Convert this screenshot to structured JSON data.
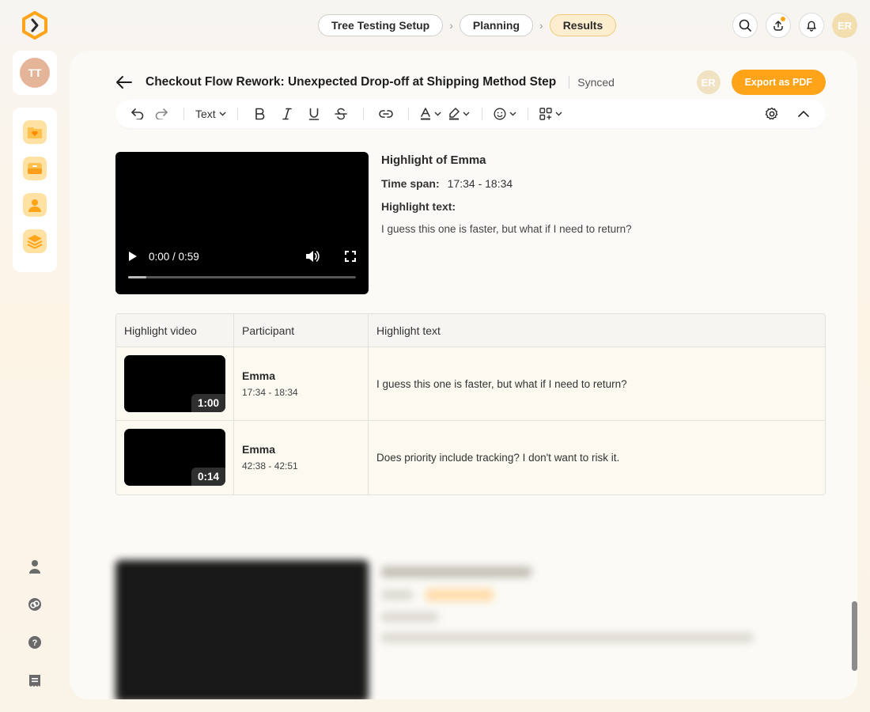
{
  "app": {
    "logo_icon": "hexagon-chevron-logo",
    "brand_color": "#ffa319"
  },
  "user": {
    "initials": "TT"
  },
  "breadcrumb": {
    "steps": [
      {
        "label": "Tree Testing Setup",
        "active": false
      },
      {
        "label": "Planning",
        "active": false
      },
      {
        "label": "Results",
        "active": true
      }
    ]
  },
  "top_actions": {
    "avatar_initials": "ER"
  },
  "document": {
    "title": "Checkout Flow Rework: Unexpected Drop-off at Shipping Method Step",
    "sync_status": "Synced",
    "collaborator_initials": "ER",
    "export_label": "Export as PDF"
  },
  "toolbar": {
    "text_style_label": "Text"
  },
  "highlight": {
    "title": "Highlight of Emma",
    "time_span_label": "Time span:",
    "time_span_value": "17:34 - 18:34",
    "text_label": "Highlight text:",
    "text_value": "I guess this one is faster, but what if I need to return?",
    "video_time": "0:00 / 0:59",
    "video_progress": 0.08
  },
  "table": {
    "headers": [
      "Highlight video",
      "Participant",
      "Highlight text"
    ],
    "rows": [
      {
        "duration": "1:00",
        "participant": "Emma",
        "time": "17:34 - 18:34",
        "text": "I guess this one is faster, but what if I need to return?"
      },
      {
        "duration": "0:14",
        "participant": "Emma",
        "time": "42:38 - 42:51",
        "text": "Does priority include tracking? I don't want to risk it."
      }
    ]
  }
}
